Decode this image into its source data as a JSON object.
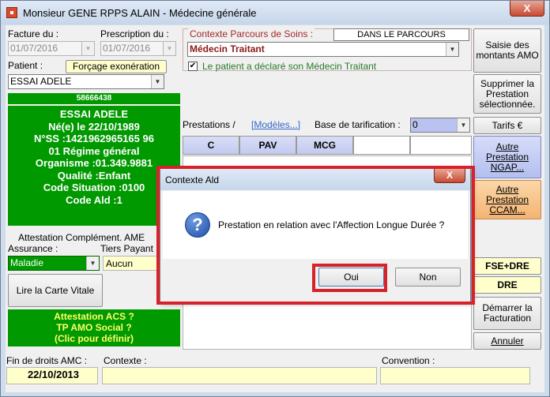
{
  "window": {
    "title": "Monsieur GENE RPPS ALAIN - Médecine générale",
    "close_label": "X"
  },
  "invoice": {
    "facture_label": "Facture du :",
    "facture_value": "01/07/2016",
    "prescription_label": "Prescription du :",
    "prescription_value": "01/07/2016",
    "patient_label": "Patient :",
    "forcage_button": "Forçage exonération",
    "patient_value": "ESSAI ADELE"
  },
  "patient_card": {
    "number": "58666438",
    "name": "ESSAI ADELE",
    "born": "Né(e) le 22/10/1989",
    "ss": "N°SS :1421962965165 96",
    "regime": "01 Régime général",
    "organisme": "Organisme :01.349.9881",
    "qualite": "Qualité :Enfant",
    "situation": "Code Situation :0100",
    "ald": "Code Ald :1"
  },
  "amc": {
    "attestation_label": "Attestation Complément. AME",
    "assurance_label": "Assurance :",
    "tiers_label": "Tiers Payant",
    "assurance_value": "Maladie",
    "tiers_value": "Aucun",
    "lire_carte_button": "Lire la Carte Vitale",
    "acs_text": [
      "Attestation ACS ?",
      "TP AMO Social ?",
      "(Clic pour définir)"
    ]
  },
  "parcours": {
    "label": "Contexte Parcours de Soins",
    "status": "DANS LE PARCOURS",
    "value": "Médecin Traitant",
    "checkbox_label": "Le patient a déclaré son Médecin Traitant"
  },
  "prestations": {
    "label": "Prestations /",
    "modeles_link": "[Modèles...]",
    "base_label": "Base de tarification :",
    "base_value": "0",
    "codes": [
      "C",
      "PAV",
      "MCG"
    ]
  },
  "right_buttons": {
    "saisie": "Saisie des montants AMO",
    "supprimer": "Supprimer la Prestation sélectionnée.",
    "tarifs": "Tarifs €",
    "autre_ngap": "Autre Prestation NGAP...",
    "autre_ccam": "Autre Prestation CCAM...",
    "fse_dre": "FSE+DRE",
    "dre": "DRE",
    "demarrer": "Démarrer la Facturation",
    "annuler": "Annuler"
  },
  "bottom": {
    "fin_droits_label": "Fin de droits AMC :",
    "fin_droits_value": "22/10/2013",
    "contexte_label": "Contexte :",
    "convention_label": "Convention :"
  },
  "dialog": {
    "title": "Contexte Ald",
    "close_label": "X",
    "message": "Prestation en relation avec l'Affection Longue Durée ?",
    "yes": "Oui",
    "no": "Non"
  }
}
